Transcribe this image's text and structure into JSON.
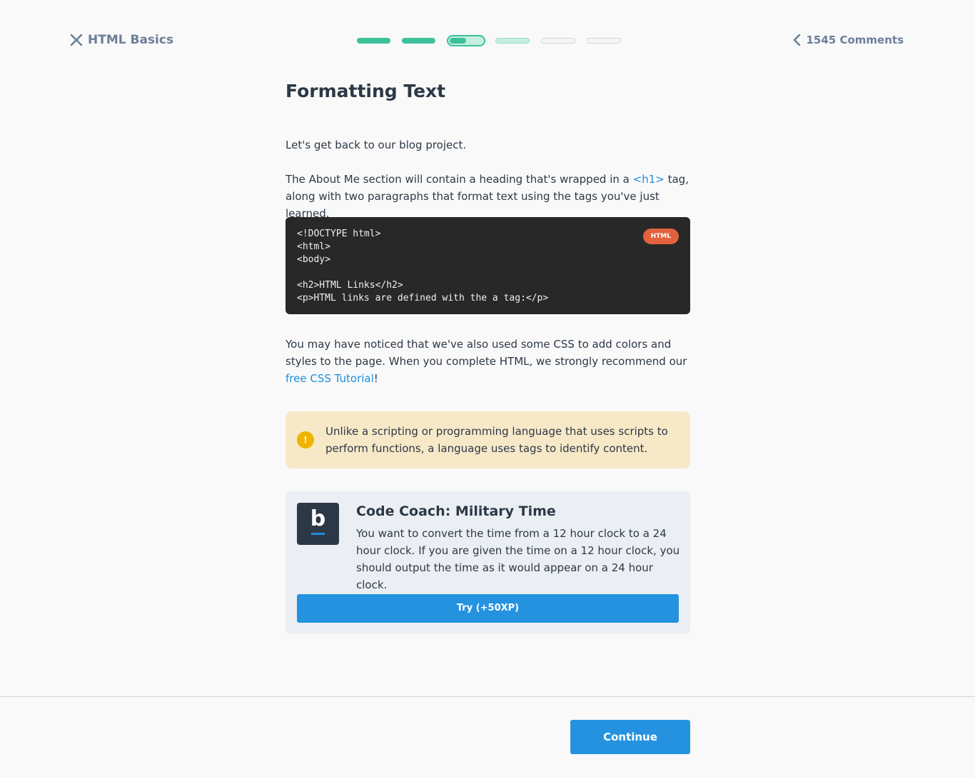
{
  "header": {
    "course_title": "HTML Basics",
    "comments_label": "1545 Comments",
    "progress": {
      "total_steps": 6,
      "completed_steps": 2,
      "current_step": 3,
      "current_step_fraction": 0.5
    }
  },
  "lesson": {
    "title": "Formatting Text",
    "paragraph_1": "Let's get back to our blog project.",
    "paragraph_2_before": "The About Me section will contain a heading that's wrapped in a ",
    "paragraph_2_tag": "<h1>",
    "paragraph_2_after": " tag, along with two paragraphs that format text using the tags you've just learned.",
    "code": {
      "language": "HTML",
      "lines": [
        "<!DOCTYPE html>",
        "<html>",
        "<body>",
        "",
        "<h2>HTML Links</h2>",
        "<p>HTML links are defined with the a tag:</p>"
      ]
    },
    "paragraph_3_before": "You may have noticed that we've also used some CSS to add colors and styles to the page. When you complete HTML, we strongly recommend our ",
    "paragraph_3_link": "free CSS Tutorial",
    "paragraph_3_after": "!",
    "note": {
      "icon": "exclamation-icon",
      "icon_glyph": "!",
      "text": "Unlike a scripting or programming language that uses scripts to perform functions, a language uses tags to identify content."
    },
    "code_coach": {
      "logo_letter": "b",
      "title": "Code Coach: Military Time",
      "description": "You want to convert the time from a 12 hour clock to a 24 hour clock. If you are given the time on a 12 hour clock, you should output the time as it would appear on a 24 hour clock.",
      "try_label": "Try (+50XP)"
    }
  },
  "footer": {
    "continue_label": "Continue"
  },
  "colors": {
    "accent_blue": "#2592e0",
    "progress_green": "#3cc19b",
    "code_bg": "#282828",
    "badge_orange": "#e2623e",
    "note_bg": "#f7e9c8",
    "warn_yellow": "#f0b400"
  }
}
